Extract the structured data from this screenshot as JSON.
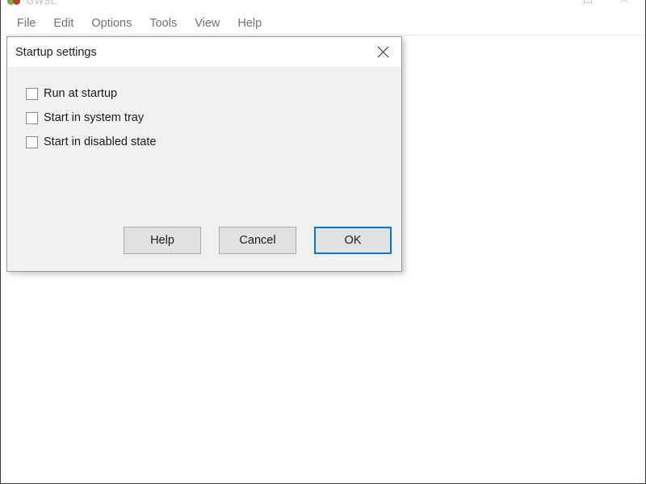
{
  "window": {
    "title": "GWSL",
    "icon": "traffic-light-icon",
    "controls": {
      "minimize": "–",
      "maximize": "☐",
      "close": "✕"
    },
    "menu": [
      {
        "label": "File"
      },
      {
        "label": "Edit"
      },
      {
        "label": "Options"
      },
      {
        "label": "Tools"
      },
      {
        "label": "View"
      },
      {
        "label": "Help"
      }
    ]
  },
  "dialog": {
    "title": "Startup settings",
    "close_icon": "close-icon",
    "checkboxes": [
      {
        "label": "Run at startup",
        "checked": false
      },
      {
        "label": "Start in system tray",
        "checked": false
      },
      {
        "label": "Start in disabled state",
        "checked": false
      }
    ],
    "buttons": [
      {
        "label": "Help",
        "default": false
      },
      {
        "label": "Cancel",
        "default": false
      },
      {
        "label": "OK",
        "default": true
      }
    ]
  },
  "colors": {
    "accent": "#0078D7",
    "dialog_background": "#F0F0F0",
    "titlebar_background": "#FFFFFF",
    "button_face": "#E1E1E1",
    "menu_text": "#6D7278",
    "icon_green": "#7AA83A",
    "icon_red": "#B5402C"
  }
}
